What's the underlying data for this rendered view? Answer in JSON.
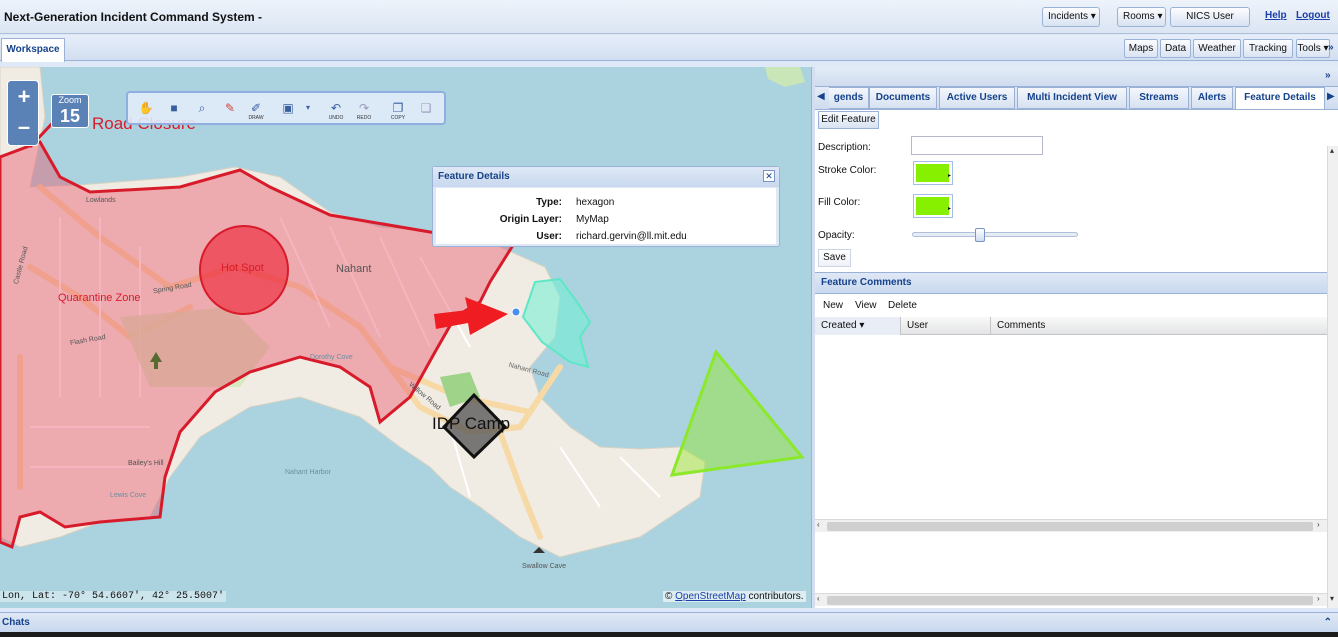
{
  "app": {
    "title": "Next-Generation Incident Command System -"
  },
  "topbar": {
    "incidents": "Incidents ▾",
    "rooms": "Rooms ▾",
    "user": "NICS User",
    "help": "Help",
    "logout": "Logout"
  },
  "workspace": {
    "tab": "Workspace",
    "right_tabs": [
      "Maps",
      "Data",
      "Weather",
      "Tracking",
      "Tools ▾"
    ],
    "collapse": "»"
  },
  "map": {
    "zoom_in": "+",
    "zoom_out": "–",
    "zoom_label": "Zoom",
    "zoom_level": "15",
    "draw_labels": {
      "draw": "DRAW",
      "undo": "UNDO",
      "redo": "REDO",
      "copy": "COPY"
    },
    "labels": {
      "road_closure": "Road Closure",
      "hot_spot": "Hot Spot",
      "quarantine_zone": "Quarantine Zone",
      "idp_camp": "IDP Camp",
      "nahant": "Nahant",
      "nahant_road": "Nahant Road",
      "spring_road": "Spring Road",
      "flash_road": "Flash Road",
      "willow_road": "Willow Road",
      "castle_road": "Castle Road",
      "swallow_cave": "Swallow Cave",
      "lowlands": "Lowlands",
      "bailey_hill": "Bailey's Hill",
      "lewis_cove": "Lewis Cove",
      "dorothy_cove": "Dorothy Cove",
      "nahant_harbor": "Nahant Harbor"
    },
    "coordinates": "Lon, Lat: -70° 54.6607', 42° 25.5007'",
    "attribution_link": "OpenStreetMap",
    "attribution_suffix": " contributors."
  },
  "feature_popup": {
    "title": "Feature Details",
    "close": "✕",
    "rows": [
      {
        "key": "Type:",
        "value": "hexagon"
      },
      {
        "key": "Origin Layer:",
        "value": "MyMap"
      },
      {
        "key": "User:",
        "value": "richard.gervin@ll.mit.edu"
      }
    ]
  },
  "panel": {
    "collapse": "»",
    "tab_left": "🡸",
    "tab_right": "🡺",
    "tabs": [
      "gends",
      "Documents",
      "Active Users",
      "Multi Incident View",
      "Streams",
      "Alerts",
      "Feature Details"
    ],
    "edit_feature": "Edit Feature",
    "description_label": "Description:",
    "description_value": "",
    "stroke_label": "Stroke Color:",
    "fill_label": "Fill Color:",
    "opacity_label": "Opacity:",
    "opacity_value": 0.4,
    "save": "Save",
    "comments_title": "Feature Comments",
    "comment_tools": [
      "New",
      "View",
      "Delete"
    ],
    "columns": [
      "Created ▾",
      "User",
      "Comments"
    ]
  },
  "colors": {
    "stroke": "#86f000",
    "fill": "#86f000",
    "accent": "#15428b"
  },
  "chat": {
    "title": "Chats",
    "collapse_icon": "⌃"
  }
}
